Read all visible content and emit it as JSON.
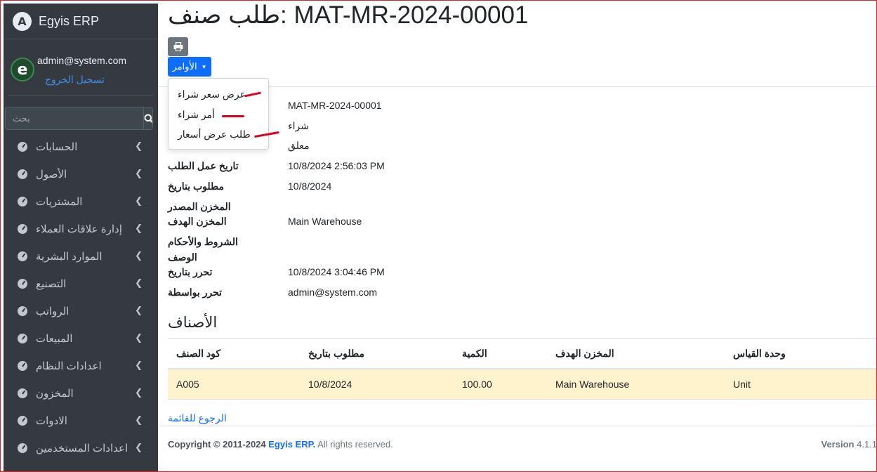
{
  "brand": {
    "name": "Egyis ERP",
    "logo_letter": "A"
  },
  "user": {
    "email": "admin@system.com",
    "logout_label": "تسجيل الخروج",
    "avatar_letter": "e"
  },
  "search": {
    "placeholder": "بحث"
  },
  "sidebar": {
    "items": [
      {
        "label": "الحسابات"
      },
      {
        "label": "الأصول"
      },
      {
        "label": "المشتريات"
      },
      {
        "label": "إدارة علاقات العملاء"
      },
      {
        "label": "الموارد البشرية"
      },
      {
        "label": "التصنيع"
      },
      {
        "label": "الرواتب"
      },
      {
        "label": "المبيعات"
      },
      {
        "label": "اعدادات النظام"
      },
      {
        "label": "المخزون"
      },
      {
        "label": "الادوات"
      },
      {
        "label": "اعدادات المستخدمين"
      }
    ]
  },
  "page": {
    "title": "طلب صنف: MAT-MR-2024-00001"
  },
  "toolbar": {
    "commands_label": "الأوامر"
  },
  "dropdown": {
    "items": [
      {
        "label": "عرض سعر شراء"
      },
      {
        "label": "أمر شراء"
      },
      {
        "label": "طلب عرض أسعار"
      }
    ]
  },
  "details": {
    "fields": [
      {
        "label": "",
        "value": "MAT-MR-2024-00001"
      },
      {
        "label": "",
        "value": "شراء"
      },
      {
        "label": "",
        "value": "معلق"
      },
      {
        "label": "تاريخ عمل الطلب",
        "value": "10/8/2024 2:56:03 PM"
      },
      {
        "label": "مطلوب بتاريخ",
        "value": "10/8/2024"
      },
      {
        "label": "المخزن المصدر",
        "value": ""
      },
      {
        "label": "المخزن الهدف",
        "value": "Main Warehouse"
      },
      {
        "label": "الشروط والأحكام",
        "value": ""
      },
      {
        "label": "الوصف",
        "value": ""
      },
      {
        "label": "تحرر بتاريخ",
        "value": "10/8/2024 3:04:46 PM"
      },
      {
        "label": "تحرر بواسطة",
        "value": "admin@system.com"
      }
    ]
  },
  "items_section": {
    "title": "الأصناف",
    "columns": [
      "كود الصنف",
      "مطلوب بتاريخ",
      "الكمية",
      "المخزن الهدف",
      "وحدة القياس"
    ],
    "rows": [
      [
        "A005",
        "10/8/2024",
        "100.00",
        "Main Warehouse",
        "Unit"
      ]
    ],
    "back_label": "الرجوع للقائمة"
  },
  "footer": {
    "copyright_prefix": "Copyright © 2011-2024",
    "brand": "Egyis ERP.",
    "rights": "All rights reserved.",
    "version_label": "Version",
    "version": "4.1.1"
  },
  "colors": {
    "primary": "#0d6efd",
    "sidebar": "#343a40",
    "row_highlight": "#fff3cd",
    "annotation": "#e0001b"
  }
}
